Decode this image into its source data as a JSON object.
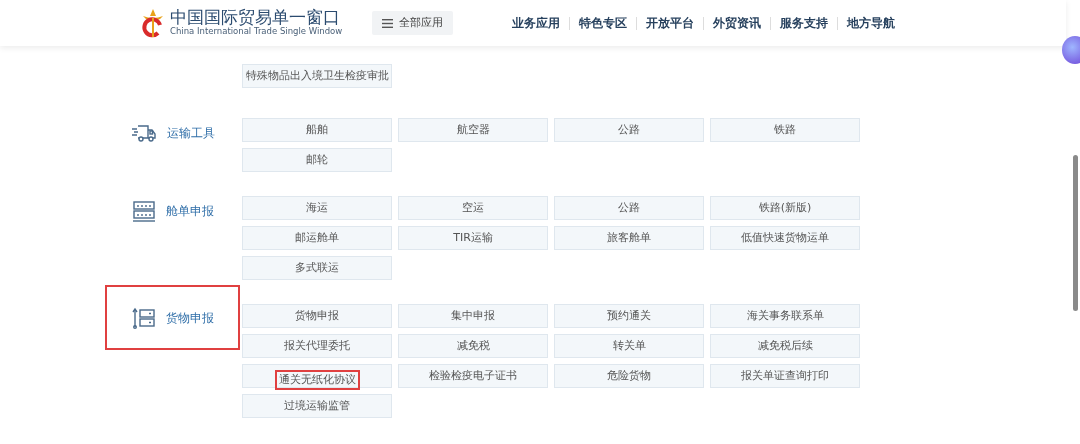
{
  "header": {
    "logo_title": "中国国际贸易单一窗口",
    "logo_subtitle": "China International Trade Single Window",
    "all_apps": "全部应用",
    "nav": [
      {
        "label": "业务应用"
      },
      {
        "label": "特色专区"
      },
      {
        "label": "开放平台"
      },
      {
        "label": "外贸资讯"
      },
      {
        "label": "服务支持"
      },
      {
        "label": "地方导航"
      }
    ]
  },
  "sections": [
    {
      "items": [
        {
          "label": "特殊物品出入境卫生检疫审批",
          "highlighted": false
        }
      ]
    },
    {
      "label": "运输工具",
      "kind": "transport",
      "highlighted": false,
      "items": [
        {
          "label": "船舶",
          "highlighted": false
        },
        {
          "label": "航空器",
          "highlighted": false
        },
        {
          "label": "公路",
          "highlighted": false
        },
        {
          "label": "铁路",
          "highlighted": false
        },
        {
          "label": "邮轮",
          "highlighted": false
        }
      ]
    },
    {
      "label": "舱单申报",
      "kind": "manifest",
      "highlighted": false,
      "items": [
        {
          "label": "海运",
          "highlighted": false
        },
        {
          "label": "空运",
          "highlighted": false
        },
        {
          "label": "公路",
          "highlighted": false
        },
        {
          "label": "铁路(新版)",
          "highlighted": false
        },
        {
          "label": "邮运舱单",
          "highlighted": false
        },
        {
          "label": "TIR运输",
          "highlighted": false
        },
        {
          "label": "旅客舱单",
          "highlighted": false
        },
        {
          "label": "低值快速货物运单",
          "highlighted": false
        },
        {
          "label": "多式联运",
          "highlighted": false
        }
      ]
    },
    {
      "label": "货物申报",
      "kind": "cargo",
      "highlighted": true,
      "items": [
        {
          "label": "货物申报",
          "highlighted": false
        },
        {
          "label": "集中申报",
          "highlighted": false
        },
        {
          "label": "预约通关",
          "highlighted": false
        },
        {
          "label": "海关事务联系单",
          "highlighted": false
        },
        {
          "label": "报关代理委托",
          "highlighted": false
        },
        {
          "label": "减免税",
          "highlighted": false
        },
        {
          "label": "转关单",
          "highlighted": false
        },
        {
          "label": "减免税后续",
          "highlighted": false
        },
        {
          "label": "通关无纸化协议",
          "highlighted": true
        },
        {
          "label": "检验检疫电子证书",
          "highlighted": false
        },
        {
          "label": "危险货物",
          "highlighted": false
        },
        {
          "label": "报关单证查询打印",
          "highlighted": false
        },
        {
          "label": "过境运输监管",
          "highlighted": false
        }
      ]
    }
  ]
}
